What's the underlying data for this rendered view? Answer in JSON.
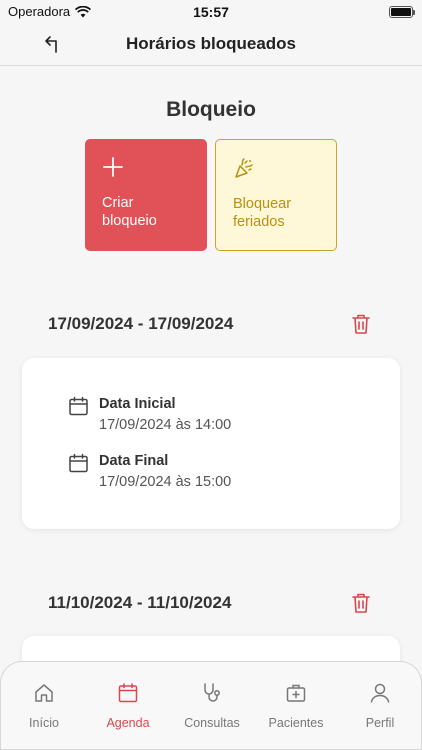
{
  "status": {
    "carrier": "Operadora",
    "time": "15:57"
  },
  "nav": {
    "title": "Horários bloqueados"
  },
  "section": {
    "title": "Bloqueio"
  },
  "actions": {
    "create_label": "Criar bloqueio",
    "holiday_label": "Bloquear feriados"
  },
  "blocks": [
    {
      "range": "17/09/2024 - 17/09/2024",
      "start_label": "Data Inicial",
      "start_value": "17/09/2024 às 14:00",
      "end_label": "Data Final",
      "end_value": "17/09/2024 às 15:00"
    },
    {
      "range": "11/10/2024 - 11/10/2024"
    }
  ],
  "tabs": [
    {
      "label": "Início",
      "icon": "home-icon",
      "active": false
    },
    {
      "label": "Agenda",
      "icon": "calendar-icon",
      "active": true
    },
    {
      "label": "Consultas",
      "icon": "stethoscope-icon",
      "active": false
    },
    {
      "label": "Pacientes",
      "icon": "medical-case-icon",
      "active": false
    },
    {
      "label": "Perfil",
      "icon": "user-icon",
      "active": false
    }
  ],
  "colors": {
    "accent": "#e05258",
    "holiday_bg": "#fff8d8",
    "holiday_fg": "#b8920e"
  }
}
